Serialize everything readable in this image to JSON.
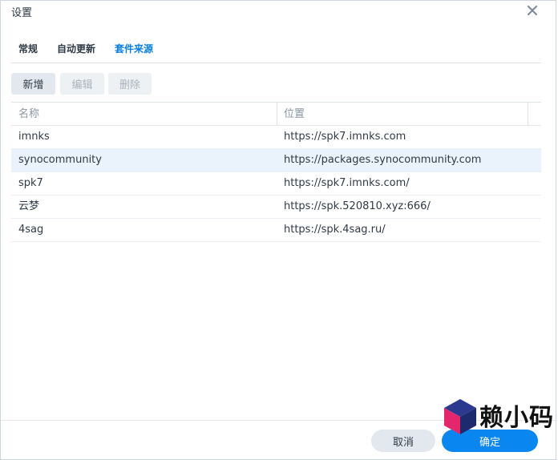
{
  "dialog": {
    "title": "设置",
    "close_icon": "close-icon"
  },
  "tabs": [
    {
      "label": "常规",
      "active": false
    },
    {
      "label": "自动更新",
      "active": false
    },
    {
      "label": "套件来源",
      "active": true
    }
  ],
  "toolbar": {
    "add_label": "新增",
    "edit_label": "编辑",
    "delete_label": "删除"
  },
  "grid": {
    "columns": [
      "名称",
      "位置"
    ],
    "rows": [
      {
        "name": "imnks",
        "location": "https://spk7.imnks.com",
        "selected": false
      },
      {
        "name": "synocommunity",
        "location": "https://packages.synocommunity.com",
        "selected": true
      },
      {
        "name": "spk7",
        "location": "https://spk7.imnks.com/",
        "selected": false
      },
      {
        "name": "云梦",
        "location": "https://spk.520810.xyz:666/",
        "selected": false
      },
      {
        "name": "4sag",
        "location": "https://spk.4sag.ru/",
        "selected": false
      }
    ]
  },
  "footer": {
    "cancel_label": "取消",
    "ok_label": "确定"
  },
  "watermark": {
    "text": "赖小码",
    "logo_icon": "cube-logo-icon"
  },
  "colors": {
    "accent": "#0a86f0",
    "active_tab": "#0a7fe0",
    "selected_row": "#eaf3fc"
  }
}
